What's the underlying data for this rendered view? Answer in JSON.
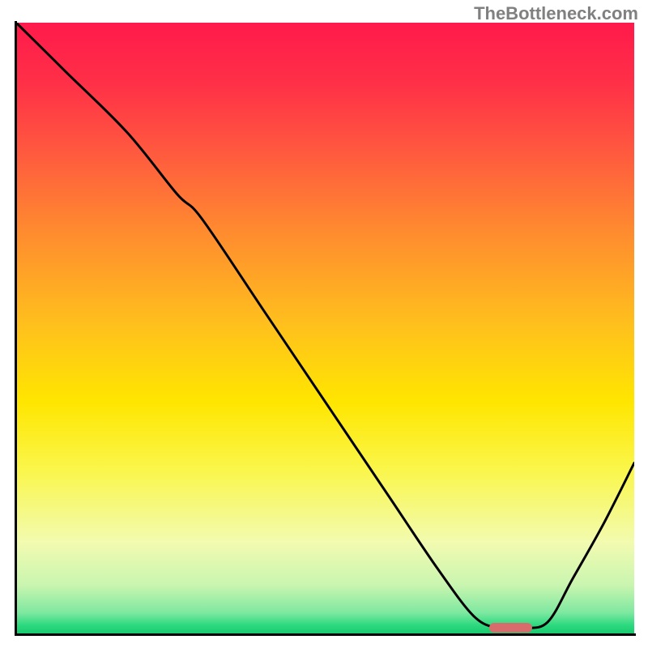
{
  "watermark": "TheBottleneck.com",
  "chart_data": {
    "type": "line",
    "title": "",
    "xlabel": "",
    "ylabel": "",
    "xlim": [
      0,
      100
    ],
    "ylim": [
      0,
      100
    ],
    "grid": false,
    "legend": false,
    "gradient_stops": [
      {
        "pos": 0.0,
        "color": "#ff1a4b"
      },
      {
        "pos": 0.1,
        "color": "#ff3047"
      },
      {
        "pos": 0.2,
        "color": "#ff5540"
      },
      {
        "pos": 0.35,
        "color": "#ff8e2e"
      },
      {
        "pos": 0.5,
        "color": "#ffc21c"
      },
      {
        "pos": 0.62,
        "color": "#ffe600"
      },
      {
        "pos": 0.73,
        "color": "#faf64a"
      },
      {
        "pos": 0.85,
        "color": "#f2fbb0"
      },
      {
        "pos": 0.92,
        "color": "#c9f5b0"
      },
      {
        "pos": 0.965,
        "color": "#7de8a0"
      },
      {
        "pos": 0.985,
        "color": "#2ed97f"
      },
      {
        "pos": 1.0,
        "color": "#17c96e"
      }
    ],
    "series": [
      {
        "name": "bottleneck-curve",
        "color": "#000000",
        "x": [
          0,
          8,
          18,
          26,
          30,
          40,
          50,
          60,
          68,
          74,
          78,
          82,
          86,
          90,
          95,
          100
        ],
        "y": [
          100,
          92,
          82,
          72,
          68,
          53,
          38,
          23,
          11,
          3,
          1,
          1,
          2,
          9,
          18,
          28
        ]
      }
    ],
    "marker": {
      "color": "#d86b6b",
      "x_center": 80,
      "y_center": 1.0,
      "width_pct": 7,
      "height_pct": 1.6
    }
  }
}
